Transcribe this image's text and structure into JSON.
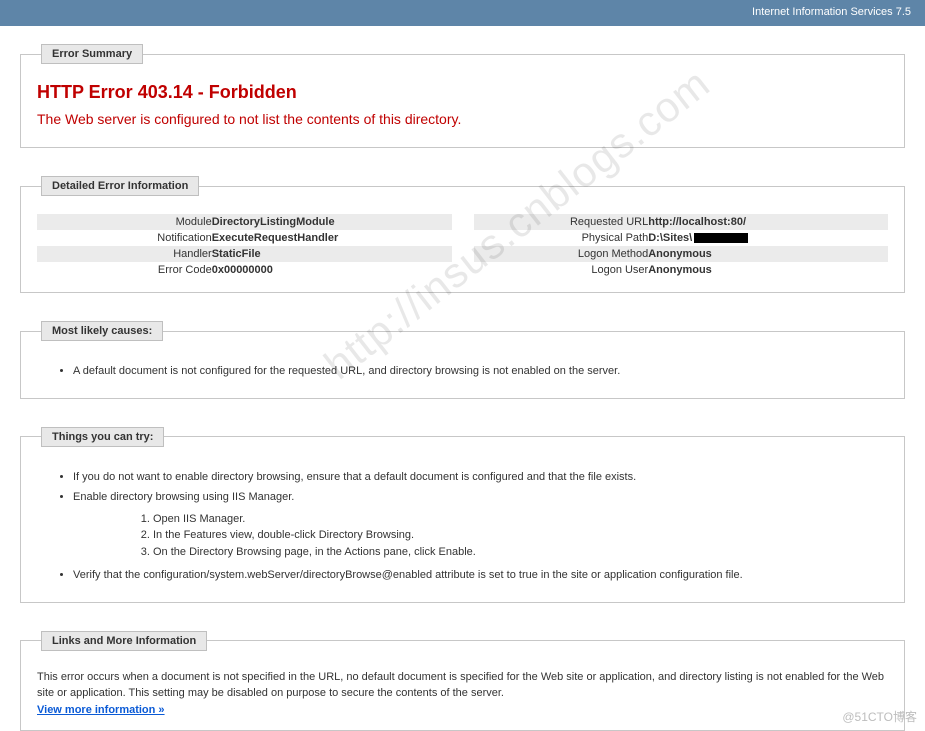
{
  "topbar": {
    "title": "Internet Information Services 7.5"
  },
  "error_summary": {
    "legend": "Error Summary",
    "heading": "HTTP Error 403.14 - Forbidden",
    "subheading": "The Web server is configured to not list the contents of this directory."
  },
  "detailed": {
    "legend": "Detailed Error Information",
    "left": [
      {
        "label": "Module",
        "value": "DirectoryListingModule"
      },
      {
        "label": "Notification",
        "value": "ExecuteRequestHandler"
      },
      {
        "label": "Handler",
        "value": "StaticFile"
      },
      {
        "label": "Error Code",
        "value": "0x00000000"
      }
    ],
    "right": [
      {
        "label": "Requested URL",
        "value": "http://localhost:80/"
      },
      {
        "label": "Physical Path",
        "value": "D:\\Sites\\",
        "redacted_suffix": true
      },
      {
        "label": "Logon Method",
        "value": "Anonymous"
      },
      {
        "label": "Logon User",
        "value": "Anonymous"
      }
    ]
  },
  "causes": {
    "legend": "Most likely causes:",
    "items": [
      "A default document is not configured for the requested URL, and directory browsing is not enabled on the server."
    ]
  },
  "things": {
    "legend": "Things you can try:",
    "items": [
      "If you do not want to enable directory browsing, ensure that a default document is configured and that the file exists.",
      "Enable directory browsing using IIS Manager."
    ],
    "steps": [
      "Open IIS Manager.",
      "In the Features view, double-click Directory Browsing.",
      "On the Directory Browsing page, in the Actions pane, click Enable."
    ],
    "trailing": [
      "Verify that the configuration/system.webServer/directoryBrowse@enabled attribute is set to true in the site or application configuration file."
    ]
  },
  "links": {
    "legend": "Links and More Information",
    "text": "This error occurs when a document is not specified in the URL, no default document is specified for the Web site or application, and directory listing is not enabled for the Web site or application. This setting may be disabled on purpose to secure the contents of the server.",
    "more": "View more information »"
  },
  "watermark": "http://insus.cnblogs.com",
  "footer_watermark": "@51CTO博客"
}
